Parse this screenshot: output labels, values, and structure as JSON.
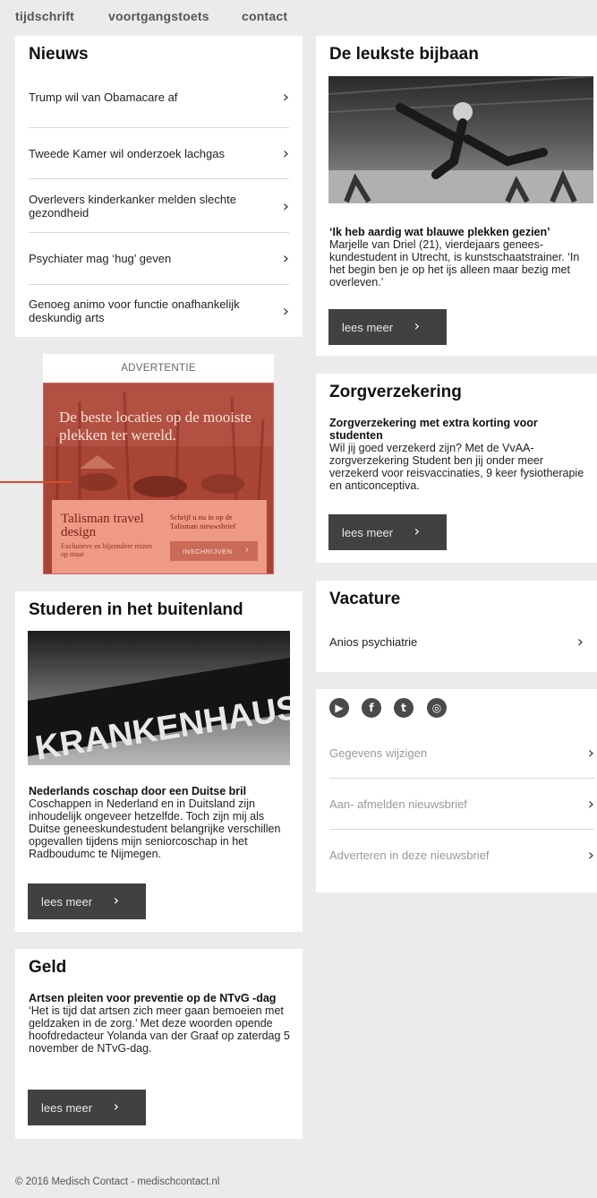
{
  "nav": [
    "tijdschrift",
    "voortgangstoets",
    "contact"
  ],
  "nieuws": {
    "title": "Nieuws",
    "items": [
      "Trump wil van Obamacare af",
      "Tweede Kamer wil onderzoek lachgas",
      "Overlevers kinderkanker melden slechte gezondheid",
      "Psychiater mag ‘hug’ geven",
      "Genoeg animo voor functie onafhankelijk deskundig arts"
    ]
  },
  "ad": {
    "label": "ADVERTENTIE",
    "headline": "De beste locaties op de mooiste plekken ter wereld.",
    "brand": "Talisman travel design",
    "subline": "Exclusieve en bijzondere reizen op maat",
    "cta": "Schrijf u nu in op de Talisman nieuwsbrief",
    "button": "INSCHRIJVEN"
  },
  "bijbaan": {
    "title": "De leukste bijbaan",
    "heading": "‘Ik heb aardig wat blauwe plekken gezien’",
    "body": "Marjelle van Driel (21), vierdejaars genees­kundestudent in Utrecht, is kunstschaatstrainer. ‘In het begin ben je op het ijs alleen maar bezig met overleven.’",
    "button": "lees meer"
  },
  "zorg": {
    "title": "Zorgverzekering",
    "heading": "Zorgverzekering met extra korting voor studenten",
    "body": "Wil jij goed verzekerd zijn? Met de VvAA-zorgverzekering Student ben jij onder meer verzekerd voor reisvaccinaties, 9 keer fysiotherapie en anticonceptiva.",
    "button": "lees meer"
  },
  "vacature": {
    "title": "Vacature",
    "item": "Anios psychiatrie"
  },
  "service": {
    "icons": [
      "youtube-icon",
      "facebook-icon",
      "twitter-icon",
      "instagram-icon"
    ],
    "items": [
      "Gegevens wijzigen",
      "Aan- afmelden nieuwsbrief",
      "Adverteren in deze nieuwsbrief"
    ]
  },
  "buitenland": {
    "title": "Studeren in het buitenland",
    "sign": "KRANKENHAUS",
    "heading": "Nederlands coschap door een Duitse bril",
    "body": "Coschappen in Nederland en in Duitsland zijn inhoudelijk ongeveer hetzelfde. Toch zijn mij als Duitse geneeskundestudent belangrijke verschillen opgevallen tijdens mijn seniorcoschap in het Radboudumc te Nijmegen.",
    "button": "lees meer"
  },
  "geld": {
    "title": "Geld",
    "heading": "Artsen pleiten voor preventie op de NTvG -dag",
    "body": "‘Het is tijd dat artsen zich meer gaan bemoeien met geldzaken in de zorg.’ Met deze woorden opende hoofdredacteur Yolanda van der Graaf op zaterdag 5 november de NTvG-dag.",
    "button": "lees meer"
  },
  "footer": "© 2016 Medisch Contact - medischcontact.nl",
  "chevron": "›"
}
